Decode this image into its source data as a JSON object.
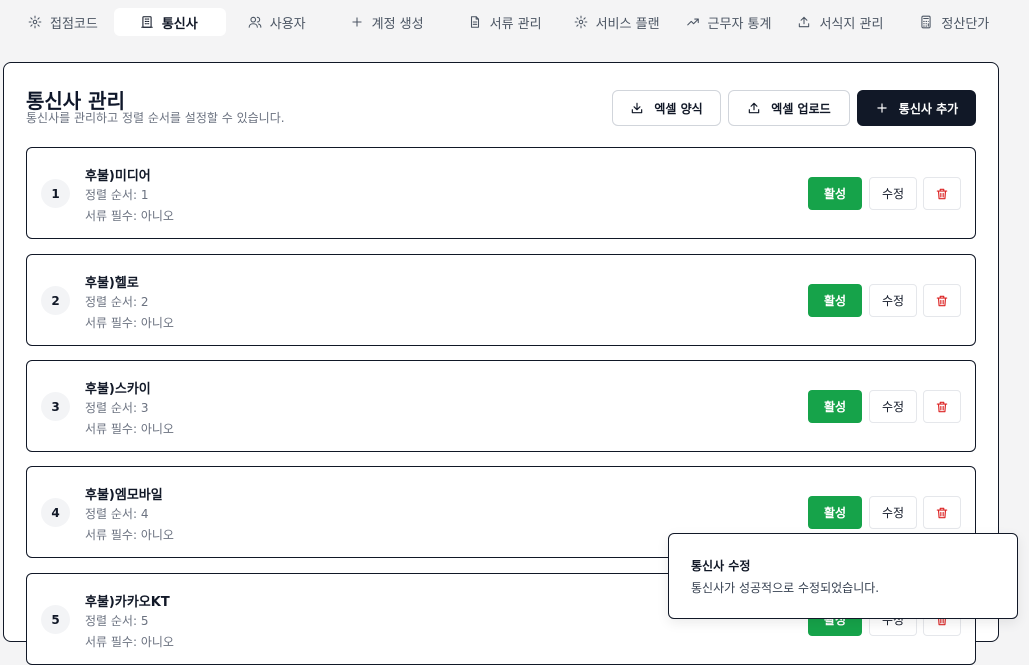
{
  "nav": {
    "tabs": [
      {
        "label": "접점코드",
        "icon": "gear-icon"
      },
      {
        "label": "통신사",
        "icon": "building-icon"
      },
      {
        "label": "사용자",
        "icon": "users-icon"
      },
      {
        "label": "계정 생성",
        "icon": "plus-icon"
      },
      {
        "label": "서류 관리",
        "icon": "document-icon"
      },
      {
        "label": "서비스 플랜",
        "icon": "gear-icon"
      },
      {
        "label": "근무자 통계",
        "icon": "trending-up-icon"
      },
      {
        "label": "서식지 관리",
        "icon": "upload-icon"
      },
      {
        "label": "정산단가",
        "icon": "calculator-icon"
      }
    ]
  },
  "header": {
    "title": "통신사 관리",
    "subtitle": "통신사를 관리하고 정렬 순서를 설정할 수 있습니다.",
    "excel_template_label": "엑셀 양식",
    "excel_upload_label": "엑셀 업로드",
    "add_carrier_label": "통신사 추가"
  },
  "carriers": [
    {
      "index": "1",
      "name": "후불)미디어",
      "sort_order": "정렬 순서: 1",
      "docs_required": "서류 필수: 아니오",
      "status_label": "활성",
      "edit_label": "수정"
    },
    {
      "index": "2",
      "name": "후불)헬로",
      "sort_order": "정렬 순서: 2",
      "docs_required": "서류 필수: 아니오",
      "status_label": "활성",
      "edit_label": "수정"
    },
    {
      "index": "3",
      "name": "후불)스카이",
      "sort_order": "정렬 순서: 3",
      "docs_required": "서류 필수: 아니오",
      "status_label": "활성",
      "edit_label": "수정"
    },
    {
      "index": "4",
      "name": "후불)엠모바일",
      "sort_order": "정렬 순서: 4",
      "docs_required": "서류 필수: 아니오",
      "status_label": "활성",
      "edit_label": "수정"
    },
    {
      "index": "5",
      "name": "후불)카카오KT",
      "sort_order": "정렬 순서: 5",
      "docs_required": "서류 필수: 아니오",
      "status_label": "활성",
      "edit_label": "수정"
    }
  ],
  "toast": {
    "title": "통신사 수정",
    "message": "통신사가 성공적으로 수정되었습니다."
  },
  "colors": {
    "active": "#16a34a",
    "primary_dark": "#111827",
    "danger": "#dc2626"
  }
}
